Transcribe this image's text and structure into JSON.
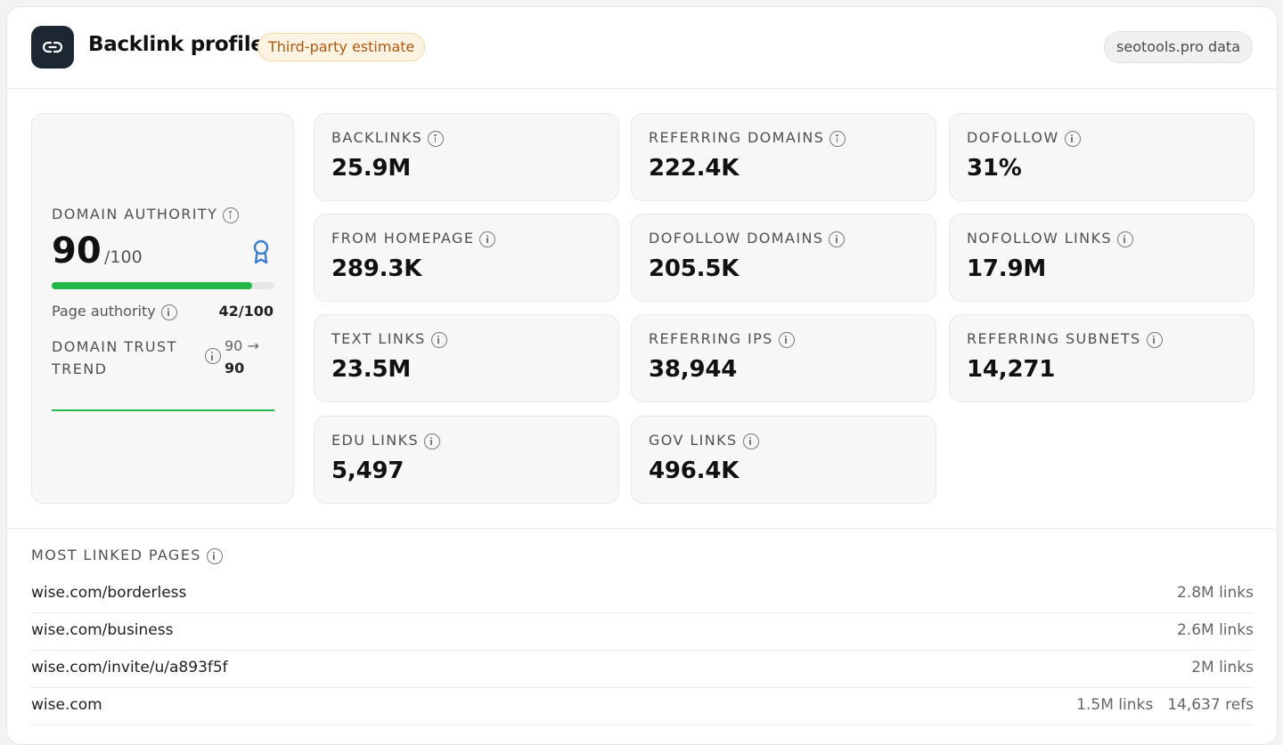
{
  "header": {
    "title": "Backlink profile",
    "badge": "Third-party estimate",
    "source": "seotools.pro data",
    "icon": "link-icon"
  },
  "domain_authority": {
    "label": "DOMAIN AUTHORITY",
    "value": "90",
    "max": "/100",
    "progress": 0.9,
    "progress_color": "#22b84b",
    "award_icon": "award-ribbon-icon",
    "page_authority_label": "Page authority",
    "page_authority_value": "42/100",
    "trend_label": "DOMAIN TRUST TREND",
    "trend_from": "90 →",
    "trend_to": "90"
  },
  "metrics": [
    {
      "label": "BACKLINKS",
      "value": "25.9M"
    },
    {
      "label": "REFERRING DOMAINS",
      "value": "222.4K"
    },
    {
      "label": "DOFOLLOW",
      "value": "31%"
    },
    {
      "label": "FROM HOMEPAGE",
      "value": "289.3K"
    },
    {
      "label": "DOFOLLOW DOMAINS",
      "value": "205.5K"
    },
    {
      "label": "NOFOLLOW LINKS",
      "value": "17.9M"
    },
    {
      "label": "TEXT LINKS",
      "value": "23.5M"
    },
    {
      "label": "REFERRING IPS",
      "value": "38,944"
    },
    {
      "label": "REFERRING SUBNETS",
      "value": "14,271"
    },
    {
      "label": "EDU LINKS",
      "value": "5,497"
    },
    {
      "label": "GOV LINKS",
      "value": "496.4K"
    }
  ],
  "most_linked": {
    "label": "MOST LINKED PAGES",
    "rows": [
      {
        "url": "wise.com/borderless",
        "links": "2.8M links",
        "refs": ""
      },
      {
        "url": "wise.com/business",
        "links": "2.6M links",
        "refs": ""
      },
      {
        "url": "wise.com/invite/u/a893f5f",
        "links": "2M links",
        "refs": ""
      },
      {
        "url": "wise.com",
        "links": "1.5M links",
        "refs": "14,637 refs"
      }
    ]
  },
  "colors": {
    "accent_green": "#22b84b",
    "badge_text": "#b0590e",
    "award_blue": "#3a7bd5"
  }
}
